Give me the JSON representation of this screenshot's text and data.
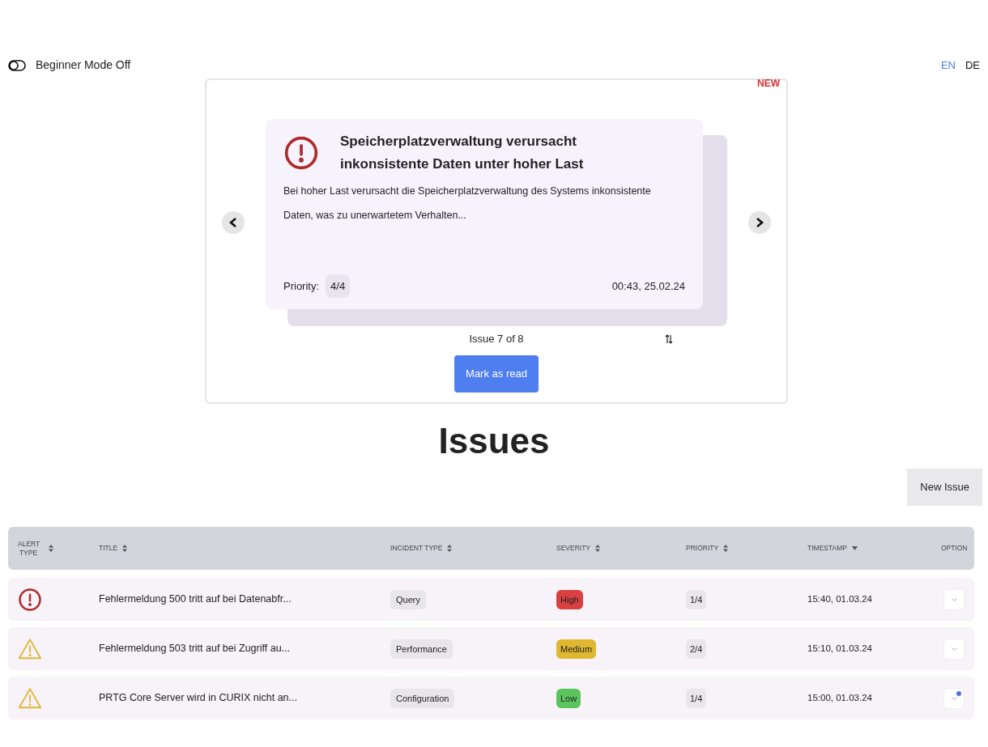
{
  "beginner_mode": {
    "label": "Beginner Mode Off",
    "on": false
  },
  "languages": [
    {
      "label": "EN",
      "selected": true
    },
    {
      "label": "DE",
      "selected": false
    }
  ],
  "carousel": {
    "badge": "NEW",
    "card": {
      "kind": "error",
      "title": "Speicherplatzverwaltung verursacht inkonsistente Daten unter hoher Last",
      "description": "Bei hoher Last verursacht die Speicherplatzverwaltung des Systems inkonsistente Daten, was zu unerwartetem Verhalten...",
      "priority_label": "Priority:",
      "priority": "4/4",
      "timestamp": "00:43, 25.02.24"
    },
    "counter": "Issue 7 of 8",
    "action": "Mark as read"
  },
  "heading": "Issues",
  "new_issue": "New Issue",
  "table": {
    "columns": [
      {
        "label": "ALERT TYPE",
        "kind": "sortable"
      },
      {
        "label": "TITLE",
        "kind": "sortable"
      },
      {
        "label": "INCIDENT TYPE",
        "kind": "sortable"
      },
      {
        "label": "SEVERITY",
        "kind": "sortable"
      },
      {
        "label": "PRIORITY",
        "kind": "sortable"
      },
      {
        "label": "TIMESTAMP",
        "kind": "descending"
      },
      {
        "label": "OPTION",
        "kind": "plain"
      }
    ],
    "rows": [
      {
        "kind": "error",
        "title": "Fehlermeldung 500 tritt auf bei Datenabfr...",
        "incident_type": "Query",
        "severity": "High",
        "color": "#d94040",
        "priority": "1/4",
        "timestamp": "15:40, 01.03.24",
        "unread": false
      },
      {
        "kind": "warning",
        "title": "Fehlermeldung 503 tritt auf bei Zugriff au...",
        "incident_type": "Performance",
        "severity": "Medium",
        "color": "#e0b730",
        "priority": "2/4",
        "timestamp": "15:10, 01.03.24",
        "unread": false
      },
      {
        "kind": "warning",
        "title": "PRTG Core Server wird in CURIX nicht an...",
        "incident_type": "Configuration",
        "severity": "Low",
        "color": "#5cc45c",
        "priority": "1/4",
        "timestamp": "15:00, 01.03.24",
        "unread": true
      }
    ]
  }
}
